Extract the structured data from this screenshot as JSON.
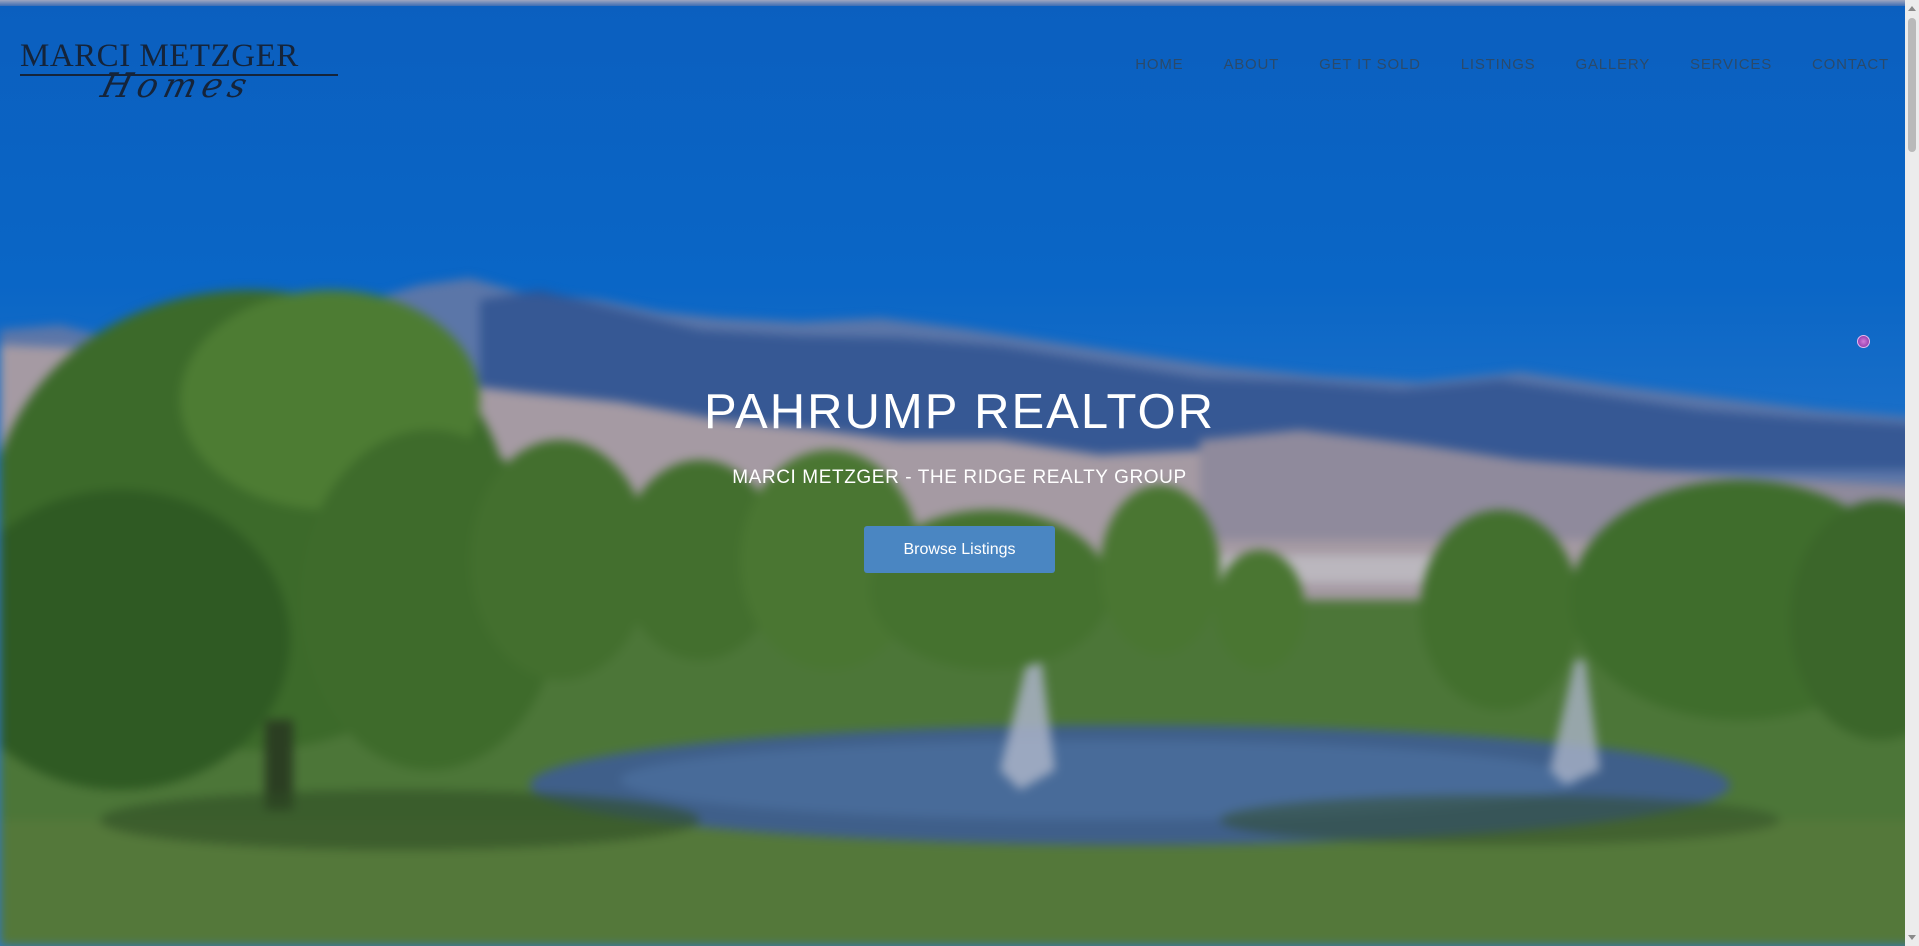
{
  "logo": {
    "main": "MARCI METZGER",
    "script": "Homes"
  },
  "nav": {
    "items": [
      "HOME",
      "ABOUT",
      "GET IT SOLD",
      "LISTINGS",
      "GALLERY",
      "SERVICES",
      "CONTACT"
    ]
  },
  "hero": {
    "title": "PAHRUMP REALTOR",
    "subtitle": "MARCI METZGER - THE RIDGE REALTY GROUP",
    "cta_label": "Browse Listings"
  },
  "colors": {
    "sky": "#0b5fbf",
    "cta": "#4a86c2",
    "logo": "#15243a",
    "nav": "#2b4a6a"
  }
}
